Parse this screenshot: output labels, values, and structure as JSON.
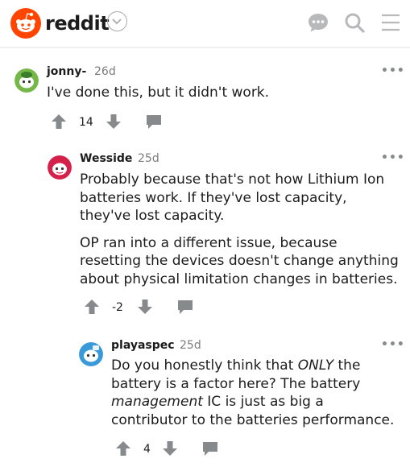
{
  "header": {
    "brand": "reddit",
    "icons": [
      "reddit-logo-icon",
      "chevron-down-icon",
      "chat-icon",
      "search-icon",
      "menu-icon"
    ],
    "accent_color": "#ff4500"
  },
  "comments": [
    {
      "username": "jonny-",
      "age": "26d",
      "more": "•••",
      "body": [
        "I've done this, but it didn't work."
      ],
      "score": "14"
    },
    {
      "username": "Wesside",
      "age": "25d",
      "more": "•••",
      "body": [
        "Probably because that's not how Lithium Ion batteries work. If they've lost capacity, they've lost capacity.",
        "OP ran into a different issue, because resetting the devices doesn't change anything about physical limitation changes in batteries."
      ],
      "score": "-2"
    },
    {
      "username": "playaspec",
      "age": "25d",
      "more": "•••",
      "body_parts": {
        "a": "Do you honestly think that ",
        "b": "ONLY",
        "c": " the battery is a factor here? The battery ",
        "d": "management",
        "e": " IC is just as big a contributor to the batteries performance."
      },
      "score": "4"
    }
  ]
}
